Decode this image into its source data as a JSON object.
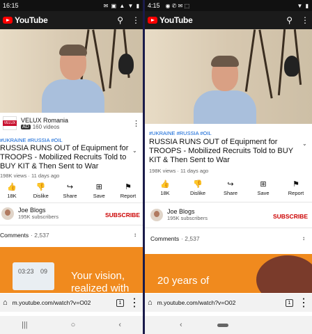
{
  "left": {
    "status": {
      "time": "16:15",
      "icons": "✉ ▣ ▲ ▼ ▮"
    },
    "yt": {
      "brand": "YouTube"
    },
    "ad": {
      "logo_text": "VELUX",
      "name": "VELUX Romania",
      "badge": "AD",
      "videos": "160 videos"
    },
    "video": {
      "tags": "#UKRAINE  #RUSSIA  #OIL",
      "title": "RUSSIA RUNS OUT of Equipment for TROOPS - Mobilized Recruits Told to BUY KIT & Then Sent to War",
      "meta": "198K views · 11 days ago"
    },
    "actions": [
      {
        "icon": "👍",
        "label": "18K",
        "name": "like"
      },
      {
        "icon": "👎",
        "label": "Dislike",
        "name": "dislike"
      },
      {
        "icon": "↪",
        "label": "Share",
        "name": "share"
      },
      {
        "icon": "⊞",
        "label": "Save",
        "name": "save"
      },
      {
        "icon": "⚑",
        "label": "Report",
        "name": "report"
      }
    ],
    "channel": {
      "name": "Joe Blogs",
      "subs": "195K subscribers",
      "subscribe": "SUBSCRIBE"
    },
    "comments": {
      "label": "Comments",
      "count": "· 2,537"
    },
    "promo": {
      "text": "Your vision, realized with",
      "tile1": "03:23",
      "tile2": "09"
    },
    "browser": {
      "url": "m.youtube.com/watch?v=O02",
      "tabs": "1"
    },
    "nav": {
      "recents": "|||",
      "home": "○",
      "back": "‹"
    }
  },
  "right": {
    "status": {
      "time": "4:15",
      "icons": "◉ ✆ ✉ ⬚"
    },
    "yt": {
      "brand": "YouTube"
    },
    "video": {
      "tags": "#UKRAINE  #RUSSIA  #OIL",
      "title": "RUSSIA RUNS OUT of Equipment for TROOPS - Mobilized Recruits Told to BUY KIT & Then Sent to War",
      "meta": "198K views · 11 days ago"
    },
    "actions": [
      {
        "icon": "👍",
        "label": "18K",
        "name": "like"
      },
      {
        "icon": "👎",
        "label": "Dislike",
        "name": "dislike"
      },
      {
        "icon": "↪",
        "label": "Share",
        "name": "share"
      },
      {
        "icon": "⊞",
        "label": "Save",
        "name": "save"
      },
      {
        "icon": "⚑",
        "label": "Report",
        "name": "report"
      }
    ],
    "channel": {
      "name": "Joe Blogs",
      "subs": "195K subscribers",
      "subscribe": "SUBSCRIBE"
    },
    "comments": {
      "label": "Comments",
      "count": "· 2,537"
    },
    "promo": {
      "text": "20 years of"
    },
    "browser": {
      "url": "m.youtube.com/watch?v=O02",
      "tabs": "1"
    },
    "nav": {
      "back": "‹"
    }
  },
  "colors": {
    "yt_red": "#ff0000",
    "subscribe": "#cc0000",
    "tag_blue": "#065fd4",
    "promo_orange": "#f08a1e"
  }
}
